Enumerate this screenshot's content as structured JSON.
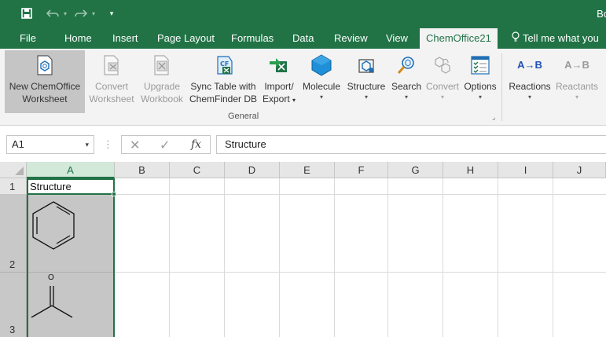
{
  "quick_access": {
    "save_icon": "save-icon",
    "undo_icon": "undo-icon",
    "redo_icon": "redo-icon",
    "customize_icon": "customize-qat-icon",
    "title_right": "Bo"
  },
  "tabs": [
    {
      "label": "File"
    },
    {
      "label": "Home"
    },
    {
      "label": "Insert"
    },
    {
      "label": "Page Layout"
    },
    {
      "label": "Formulas"
    },
    {
      "label": "Data"
    },
    {
      "label": "Review"
    },
    {
      "label": "View"
    },
    {
      "label": "ChemOffice21"
    }
  ],
  "tell_me": "Tell me what you",
  "ribbon": {
    "buttons": [
      {
        "line1": "New ChemOffice",
        "line2": "Worksheet",
        "icon": "new-worksheet-icon"
      },
      {
        "line1": "Convert",
        "line2": "Worksheet",
        "icon": "convert-worksheet-icon"
      },
      {
        "line1": "Upgrade",
        "line2": "Workbook",
        "icon": "upgrade-workbook-icon"
      },
      {
        "line1": "Sync Table with",
        "line2": "ChemFinder DB",
        "icon": "sync-table-icon"
      },
      {
        "line1": "Import/",
        "line2": "Export",
        "icon": "import-export-icon"
      },
      {
        "line1": "Molecule",
        "line2": "",
        "icon": "molecule-icon"
      },
      {
        "line1": "Structure",
        "line2": "",
        "icon": "structure-icon"
      },
      {
        "line1": "Search",
        "line2": "",
        "icon": "search-icon"
      },
      {
        "line1": "Convert",
        "line2": "",
        "icon": "convert-icon"
      },
      {
        "line1": "Options",
        "line2": "",
        "icon": "options-icon"
      },
      {
        "line1": "Reactions",
        "line2": "",
        "icon": "reactions-icon",
        "glyph": "A→B"
      },
      {
        "line1": "Reactants",
        "line2": "",
        "icon": "reactants-icon",
        "glyph": "A→B"
      }
    ],
    "group_label": "General"
  },
  "formula_bar": {
    "name_box": "A1",
    "cancel": "✕",
    "enter": "✓",
    "fx": "fx",
    "content": "Structure"
  },
  "sheet": {
    "columns": [
      "A",
      "B",
      "C",
      "D",
      "E",
      "F",
      "G",
      "H",
      "I",
      "J"
    ],
    "rows": [
      "1",
      "2",
      "3"
    ],
    "cell_a1": "Structure",
    "acetone_label": "O"
  },
  "colors": {
    "excel_green": "#217346",
    "ribbon_bg": "#f3f3f3",
    "selection_gray": "#c6c6c6"
  }
}
